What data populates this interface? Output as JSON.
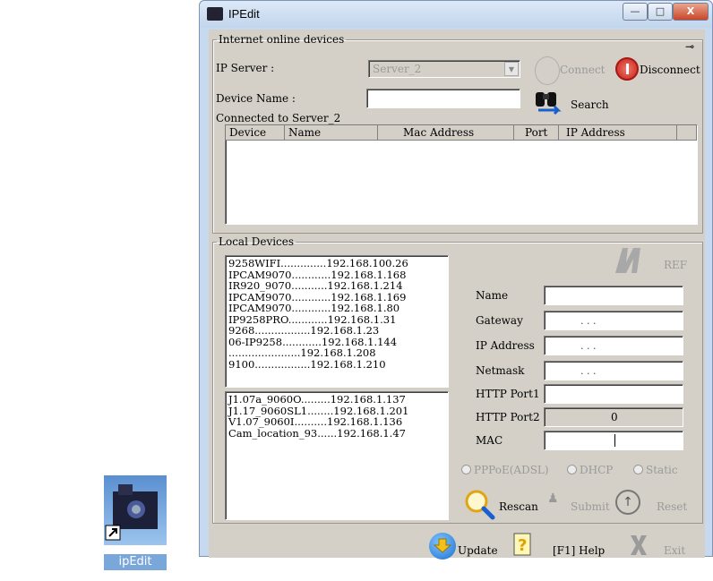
{
  "desktop": {
    "shortcut_label": "ipEdit"
  },
  "window": {
    "title": "IPEdit",
    "minimize": "—",
    "maximize": "□",
    "close": "X"
  },
  "online": {
    "group_title": "Internet online devices",
    "ip_server_label": "IP Server :",
    "ip_server_value": "Server_2",
    "connect_label": "Connect",
    "disconnect_label": "Disconnect",
    "device_name_label": "Device Name :",
    "device_name_value": "",
    "search_label": "Search",
    "connected_label": "Connected to Server_2",
    "table_headers": [
      "Device",
      "Name",
      "Mac Address",
      "Port",
      "IP Address"
    ]
  },
  "local": {
    "group_title": "Local Devices",
    "list1": [
      "9258WIFI..............192.168.100.26",
      "IPCAM9070............192.168.1.168",
      "IR920_9070...........192.168.1.214",
      "IPCAM9070............192.168.1.169",
      "IPCAM9070............192.168.1.80",
      "IP9258PRO............192.168.1.31",
      "9268.................192.168.1.23",
      "06-IP9258............192.168.1.144",
      "......................192.168.1.208",
      "9100.................192.168.1.210"
    ],
    "list2": [
      "J1.07a_9060O.........192.168.1.137",
      "J1.17_9060SL1........192.168.1.201",
      "V1.07_9060I..........192.168.1.136",
      "Cam_location_93......192.168.1.47"
    ],
    "ref_label": "REF",
    "fields": {
      "name_label": "Name",
      "gateway_label": "Gateway",
      "ip_label": "IP Address",
      "netmask_label": "Netmask",
      "http1_label": "HTTP Port1",
      "http2_label": "HTTP Port2",
      "http2_value": "0",
      "mac_label": "MAC",
      "dots": ".           .           ."
    },
    "modes": [
      "PPPoE(ADSL)",
      "DHCP",
      "Static"
    ],
    "rescan_label": "Rescan",
    "submit_label": "Submit",
    "reset_label": "Reset"
  },
  "footer": {
    "update_label": "Update",
    "help_label": "[F1] Help",
    "exit_label": "Exit"
  },
  "colors": {
    "disconnect_red": "#d2261b",
    "update_blue": "#1f6fcf",
    "search_blue": "#1a5fd0"
  }
}
